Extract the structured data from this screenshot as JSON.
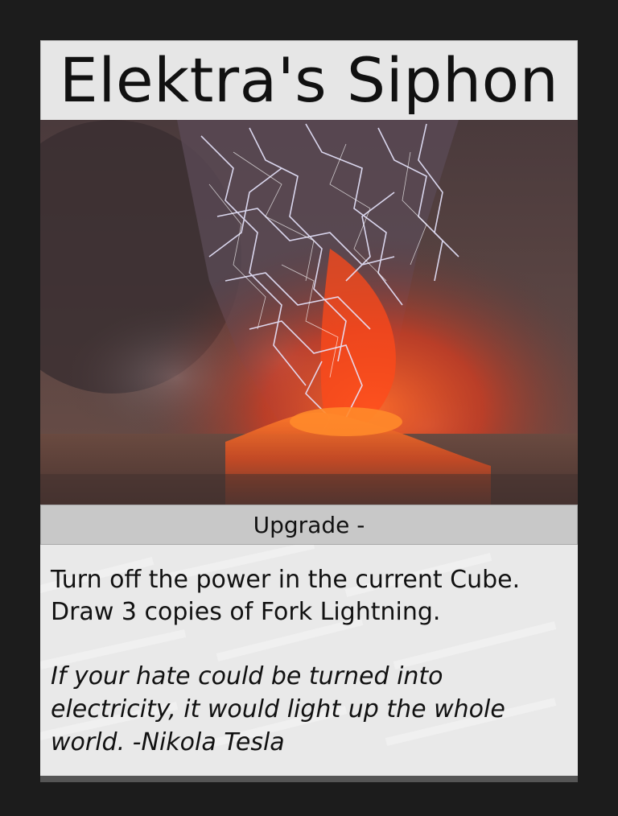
{
  "card": {
    "title": "Elektra's Siphon",
    "type_line": "Upgrade -",
    "rules_text": "Turn off the power in the current Cube. Draw 3 copies of Fork Lightning.",
    "flavor_text": "If your hate could be turned into electricity, it would light up the whole world. -Nikola Tesla",
    "art": "volcano-eruption-with-lightning-image"
  },
  "colors": {
    "background": "#1c1c1c",
    "title_bar": "#e6e6e6",
    "type_bar": "#c8c8c8",
    "text_box": "#e9e9e9",
    "lava": "#ff4a1a",
    "lightning": "#e8e6ff"
  }
}
